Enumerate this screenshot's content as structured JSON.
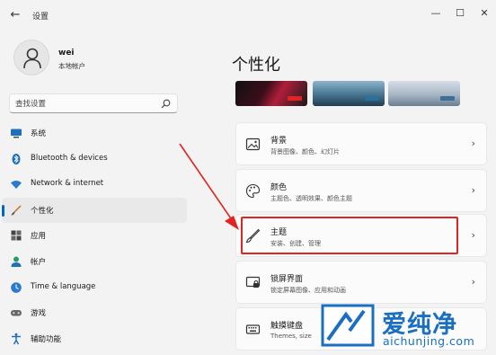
{
  "titlebar": {
    "back_glyph": "←",
    "title": "设置",
    "controls": [
      "—",
      "☐",
      "✕"
    ]
  },
  "user": {
    "name": "wei",
    "type": "本地帐户",
    "avatar_icon": "person-icon"
  },
  "search": {
    "placeholder": "查找设置",
    "icon": "search-icon"
  },
  "sidebar": {
    "items": [
      {
        "label": "系统",
        "icon": "monitor-icon"
      },
      {
        "label": "Bluetooth & devices",
        "icon": "bluetooth-icon"
      },
      {
        "label": "Network & internet",
        "icon": "wifi-icon"
      },
      {
        "label": "个性化",
        "icon": "brush-icon",
        "active": true
      },
      {
        "label": "应用",
        "icon": "apps-icon"
      },
      {
        "label": "帐户",
        "icon": "account-icon"
      },
      {
        "label": "Time & language",
        "icon": "globe-clock-icon"
      },
      {
        "label": "游戏",
        "icon": "gamepad-icon"
      },
      {
        "label": "辅助功能",
        "icon": "accessibility-icon"
      }
    ]
  },
  "main": {
    "title": "个性化",
    "cards": [
      {
        "title": "背景",
        "subtitle": "背景图像、颜色、幻灯片",
        "icon": "image-icon"
      },
      {
        "title": "颜色",
        "subtitle": "主题色、透明效果、颜色主题",
        "icon": "palette-icon"
      },
      {
        "title": "主题",
        "subtitle": "安装、创建、管理",
        "icon": "brush-icon"
      },
      {
        "title": "锁屏界面",
        "subtitle": "锁定屏幕图像、应用和动画",
        "icon": "lock-screen-icon"
      },
      {
        "title": "触摸键盘",
        "subtitle": "Themes, size",
        "icon": "keyboard-icon"
      }
    ],
    "chevron": "›"
  },
  "colors": {
    "accent": "#0067c0",
    "highlight": "#e02424",
    "watermark": "#1a6fc2"
  },
  "watermark": {
    "cn": "爱纯净",
    "en": "aichunjing.com"
  }
}
